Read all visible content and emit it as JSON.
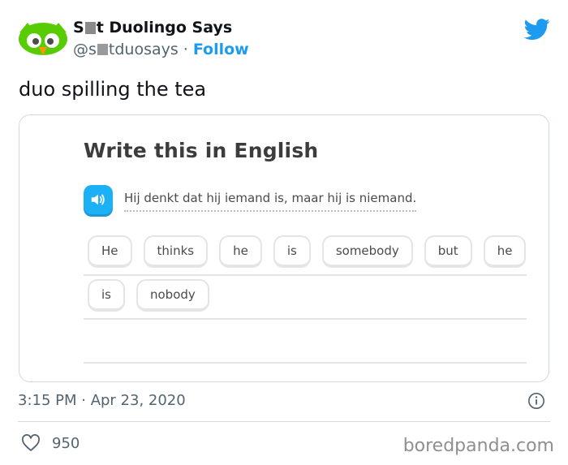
{
  "author": {
    "name_start": "S",
    "name_end": "t Duolingo Says",
    "handle_start": "@s",
    "handle_end": "tduosays",
    "separator": "·",
    "follow_label": "Follow"
  },
  "tweet": {
    "text": "duo spilling the tea",
    "timestamp": "3:15 PM · Apr 23, 2020",
    "like_count": "950"
  },
  "card": {
    "title": "Write this in English",
    "sentence": "Hij denkt dat hij iemand is, maar hij is niemand.",
    "row1": [
      "He",
      "thinks",
      "he",
      "is",
      "somebody",
      "but",
      "he"
    ],
    "row2": [
      "is",
      "nobody"
    ]
  },
  "watermark": "boredpanda.com",
  "colors": {
    "twitter_blue": "#1d9bf0",
    "duo_blue": "#1cb0f6",
    "owl_green": "#58cc02"
  },
  "icons": [
    "duo-owl-avatar",
    "twitter-bird-icon",
    "speaker-icon",
    "info-icon",
    "heart-icon"
  ]
}
